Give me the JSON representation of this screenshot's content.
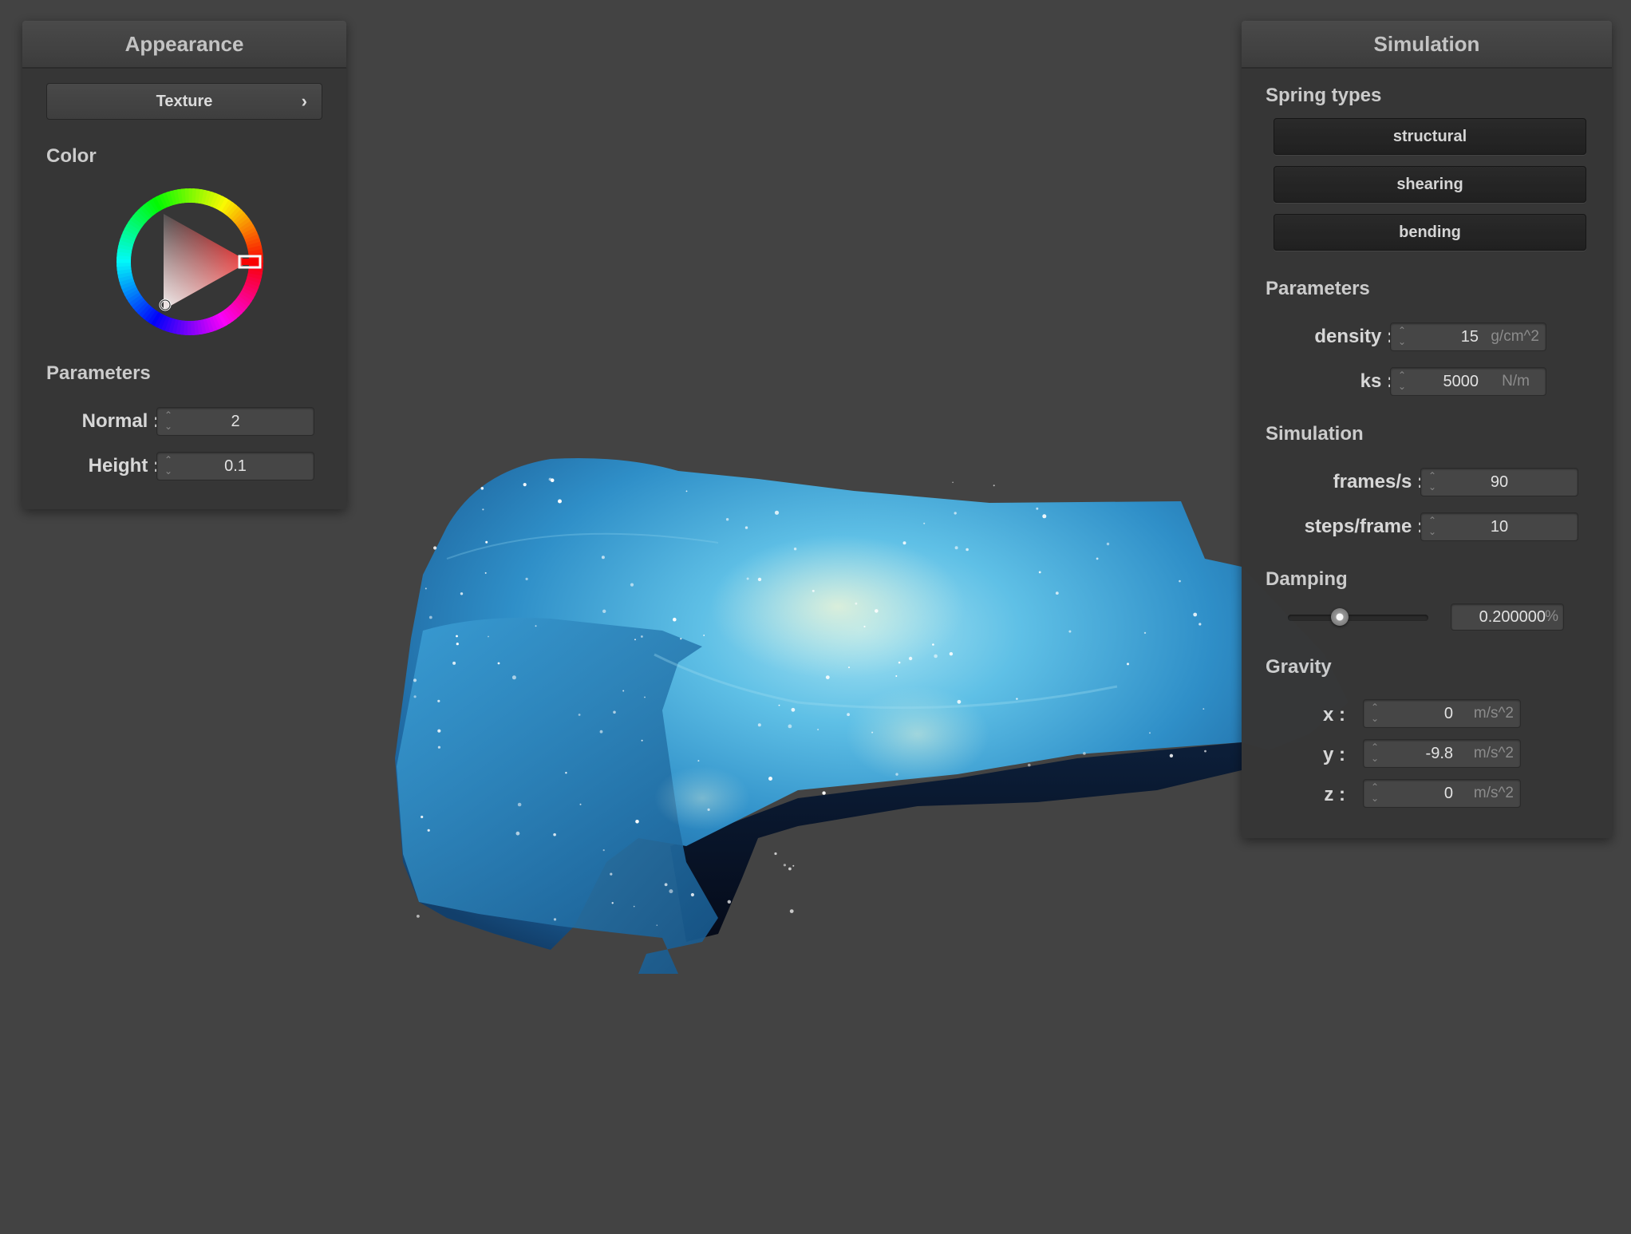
{
  "appearance": {
    "title": "Appearance",
    "texture_label": "Texture",
    "texture_chevron": "›",
    "color_label": "Color",
    "parameters_label": "Parameters",
    "normal_label": "Normal :",
    "normal_value": "2",
    "height_label": "Height :",
    "height_value": "0.1",
    "selected_color": "#ff0000"
  },
  "simulation": {
    "title": "Simulation",
    "spring_types_label": "Spring types",
    "spring_types": [
      "structural",
      "shearing",
      "bending"
    ],
    "parameters_label": "Parameters",
    "density_label": "density :",
    "density_value": "15",
    "density_unit": "g/cm^2",
    "ks_label": "ks :",
    "ks_value": "5000",
    "ks_unit": "N/m",
    "simulation_label": "Simulation",
    "fps_label": "frames/s :",
    "fps_value": "90",
    "steps_label": "steps/frame :",
    "steps_value": "10",
    "damping_label": "Damping",
    "damping_slider_fraction": 0.2,
    "damping_value": "0.200000",
    "damping_unit": "%",
    "gravity_label": "Gravity",
    "gx_label": "x :",
    "gx_value": "0",
    "gy_label": "y :",
    "gy_value": "-9.8",
    "gz_label": "z :",
    "gz_value": "0",
    "gravity_unit": "m/s^2"
  },
  "icons": {
    "spin": "up-down-arrows-icon",
    "chevron": "chevron-right-icon",
    "color_wheel": "color-wheel-icon"
  },
  "colors": {
    "background": "#434343",
    "panel": "#363636",
    "cloth_light": "#6fc6ea",
    "cloth_dark": "#0a1528"
  }
}
